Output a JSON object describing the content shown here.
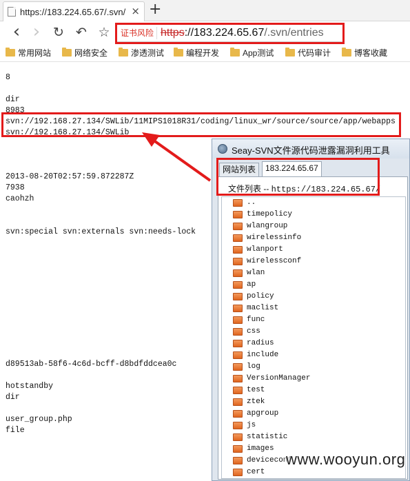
{
  "browser": {
    "tab_title": "https://183.224.65.67/.svn/",
    "tab_close": "×",
    "new_tab": "+",
    "nav": {
      "back": "‹",
      "forward": "›",
      "reload": "↻",
      "undo": "↶",
      "bookmark": "☆"
    },
    "cert_warning": "证书风险",
    "url_scheme": "https",
    "url_sep": "://",
    "url_host": "183.224.65.67",
    "url_path": "/.svn/entries",
    "bookmarks": [
      "常用网站",
      "网络安全",
      "渗透测试",
      "编程开发",
      "App测试",
      "代码审计",
      "博客收藏"
    ]
  },
  "document": {
    "lines": [
      "8",
      "dir",
      "8983",
      "svn://192.168.27.134/SWLib/11MIPS1018R31/coding/linux_wr/source/source/app/webapps",
      "svn://192.168.27.134/SWLib",
      "2013-08-20T02:57:59.872287Z",
      "7938",
      "caohzh",
      "svn:special svn:externals svn:needs-lock",
      "d89513ab-58f6-4c6d-bcff-d8bdfddcea0c",
      "hotstandby",
      "dir",
      "user_group.php",
      "file"
    ]
  },
  "tool": {
    "title": "Seay-SVN文件源代码泄露漏洞利用工具",
    "tabs": [
      "网站列表",
      "183.224.65.67"
    ],
    "path_label": "文件列表 -- ",
    "path_url": "https://183.224.65.67/",
    "files": [
      "..",
      "timepolicy",
      "wlangroup",
      "wirelessinfo",
      "wlanport",
      "wirelessconf",
      "wlan",
      "ap",
      "policy",
      "maclist",
      "func",
      "css",
      "radius",
      "include",
      "log",
      "VersionManager",
      "test",
      "ztek",
      "apgroup",
      "js",
      "statistic",
      "images",
      "deviceconf",
      "cert"
    ]
  },
  "watermark": "www.wooyun.org",
  "colors": {
    "highlight": "#e31b1b",
    "cert_warning": "#d93025",
    "folder": "#e8b84a",
    "file_icon": "#e0651f"
  }
}
